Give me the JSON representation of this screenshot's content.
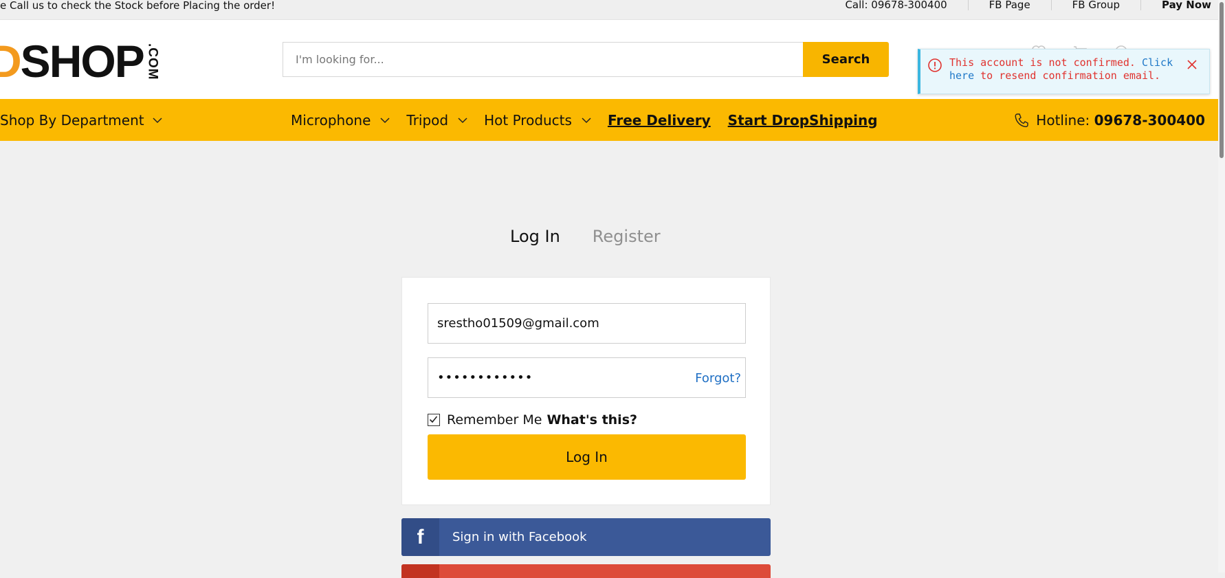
{
  "topbar": {
    "notice": "e Call us to check the Stock before Placing the order!",
    "links": [
      "Call: 09678-300400",
      "FB Page",
      "FB Group",
      "Pay Now"
    ]
  },
  "header": {
    "logo": {
      "prefix": "D",
      "main": "SHOP",
      "suffix": ".COM"
    },
    "search": {
      "placeholder": "I'm looking for...",
      "value": "",
      "button": "Search"
    }
  },
  "alert": {
    "message": "This account is not confirmed. ",
    "link": "Click here",
    "message_end": " to resend confirmation email."
  },
  "nav": {
    "department": "Shop By Department",
    "items": [
      "Microphone",
      "Tripod",
      "Hot Products"
    ],
    "links": [
      "Free Delivery",
      "Start DropShipping"
    ],
    "hotline_label": "Hotline: ",
    "hotline_number": "09678-300400"
  },
  "auth": {
    "tabs": {
      "login": "Log In",
      "register": "Register"
    },
    "email_value": "srestho01509@gmail.com",
    "password_masked": "••••••••••••",
    "forgot": "Forgot?",
    "remember_label": "Remember Me",
    "remember_checked": true,
    "whats_this": "What's this?",
    "login_button": "Log In",
    "facebook_button": "Sign in with Facebook"
  },
  "colors": {
    "brand_yellow": "#fbb901",
    "logo_orange": "#f39a1e",
    "facebook_blue": "#3b5998",
    "google_red": "#dd4b39",
    "alert_text": "#e0322e"
  }
}
